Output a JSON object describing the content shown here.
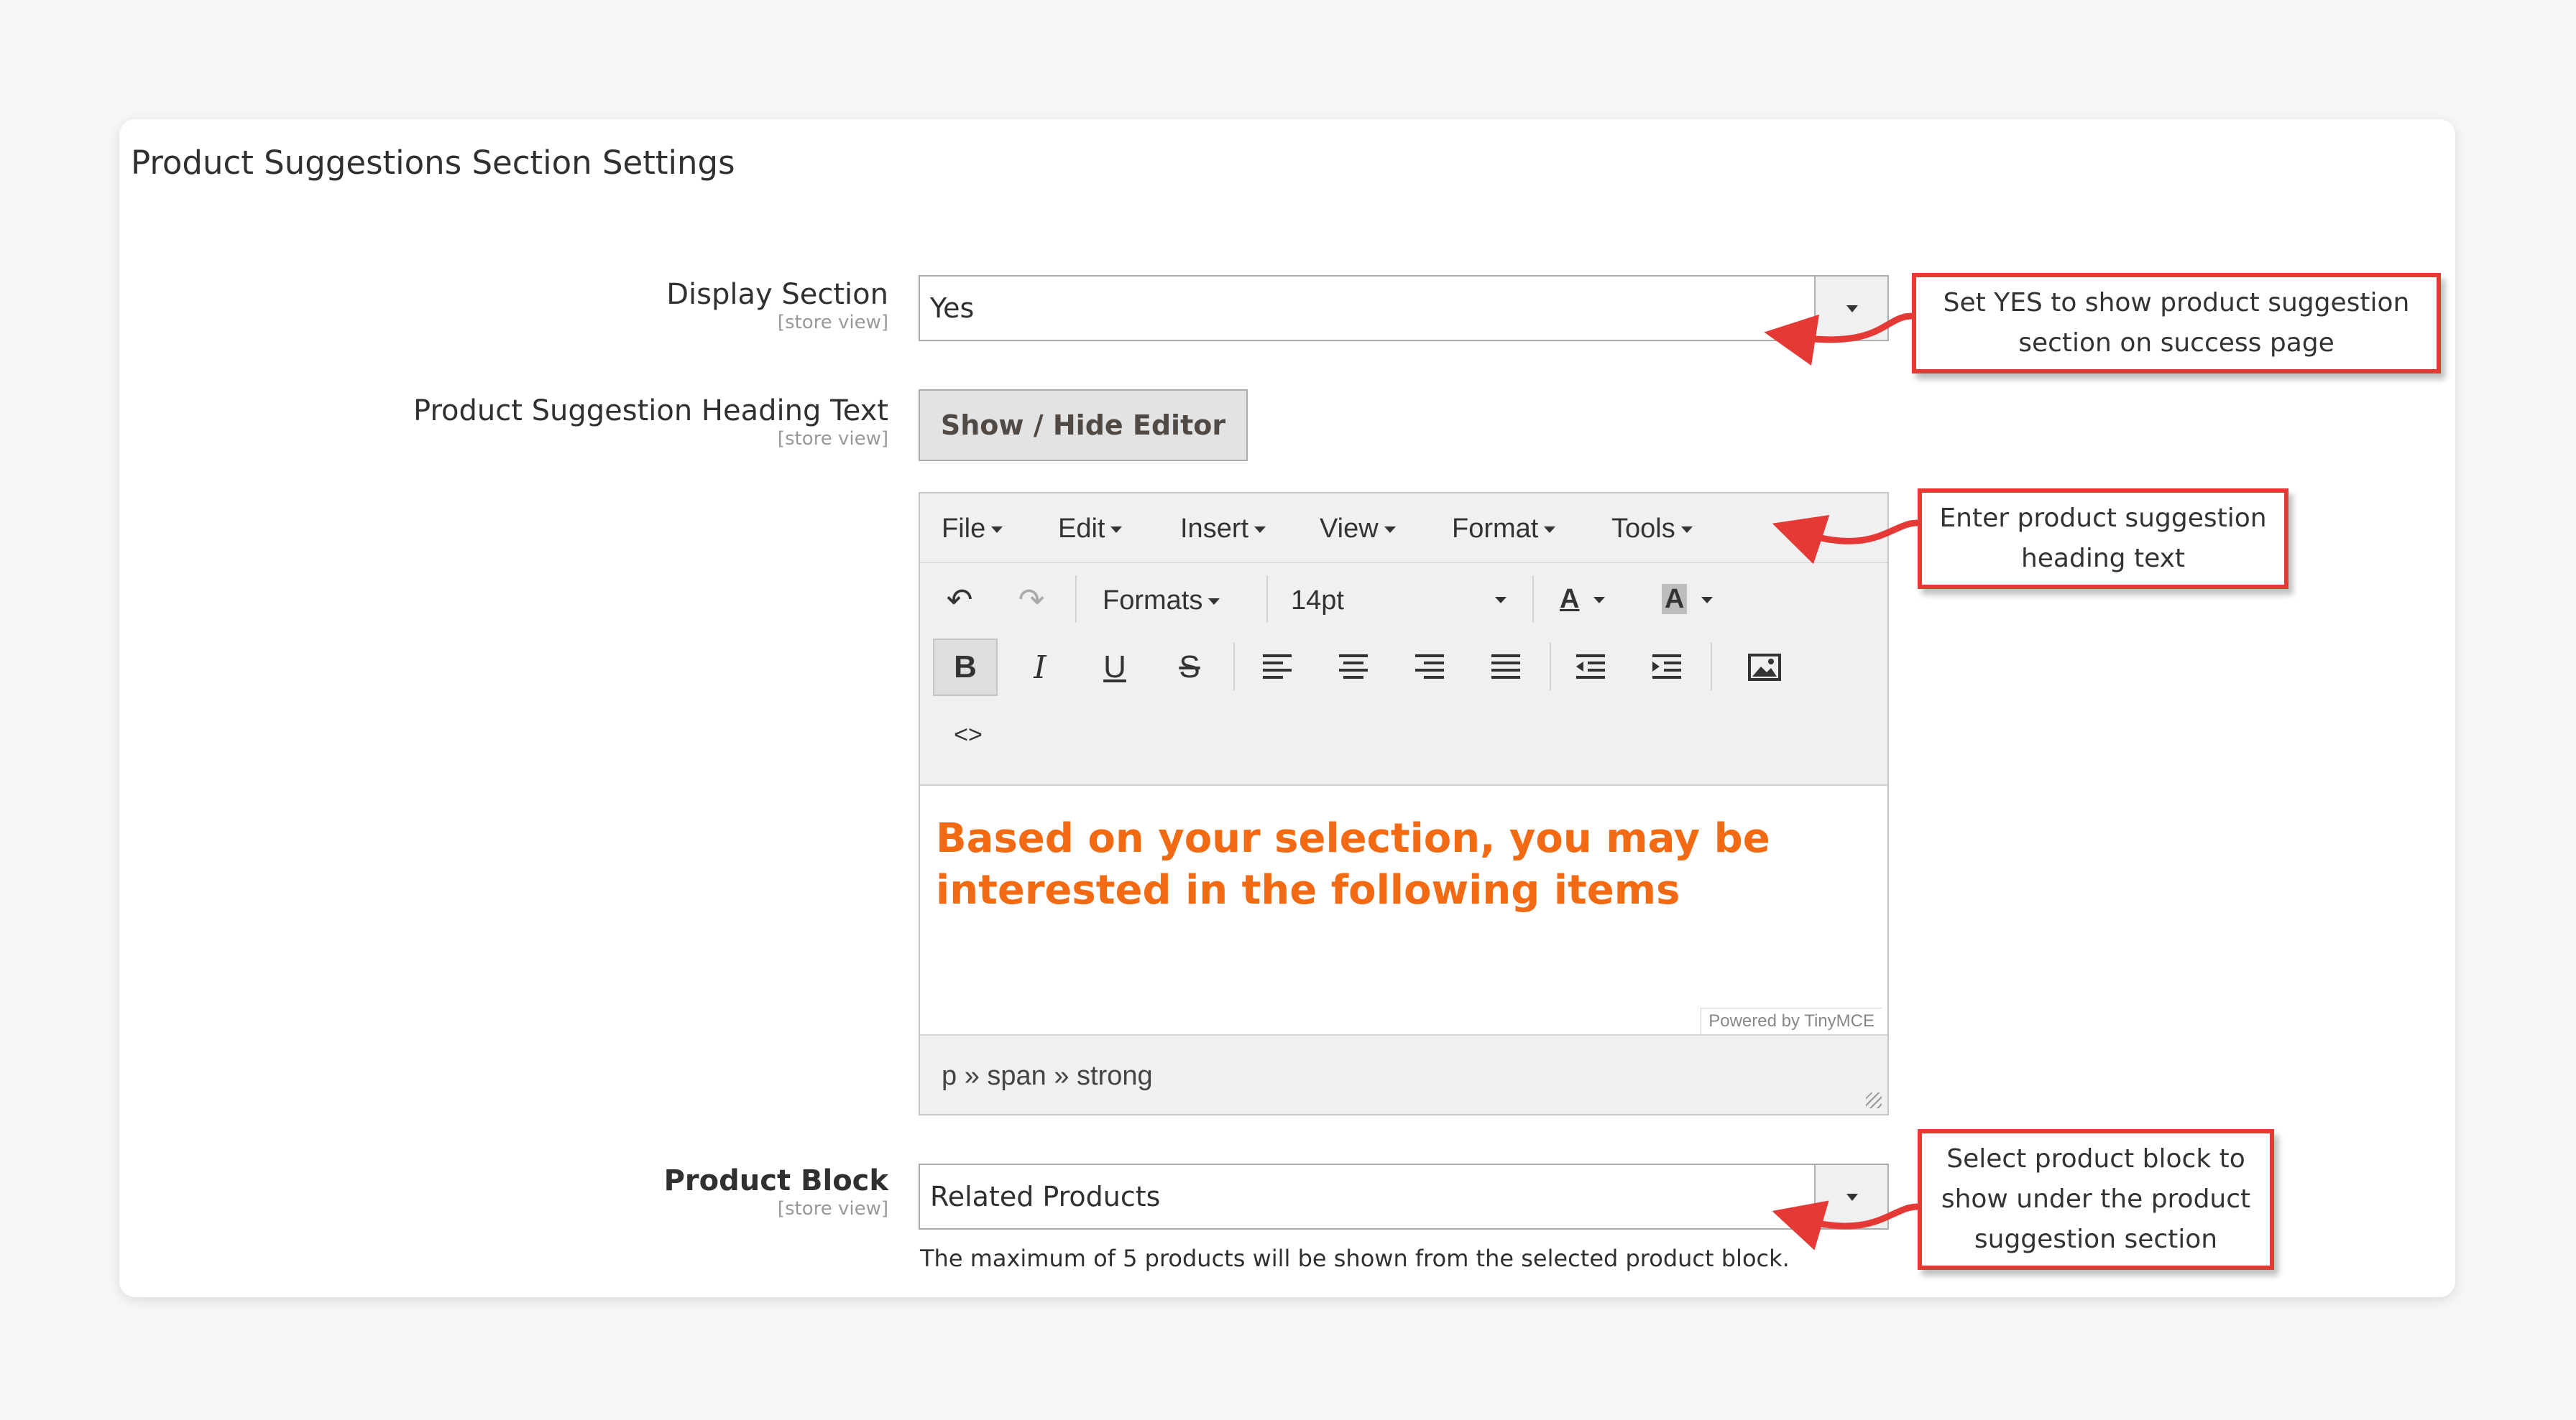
{
  "section": {
    "title": "Product Suggestions Section Settings"
  },
  "scope_label": "[store view]",
  "display_section": {
    "label": "Display Section",
    "value": "Yes"
  },
  "heading_text": {
    "label": "Product Suggestion Heading Text",
    "toggle_button": "Show / Hide Editor"
  },
  "editor": {
    "menus": [
      "File",
      "Edit",
      "Insert",
      "View",
      "Format",
      "Tools"
    ],
    "formats_label": "Formats",
    "font_size": "14pt",
    "text_color_glyph": "A",
    "bg_color_glyph": "A",
    "content": "Based on your selection, you may be interested in the following items",
    "content_color": "#f26a13",
    "powered_by": "Powered by TinyMCE",
    "status_path": "p » span » strong",
    "icons": [
      "undo-icon",
      "redo-icon",
      "bold-icon",
      "italic-icon",
      "underline-icon",
      "strikethrough-icon",
      "align-left-icon",
      "align-center-icon",
      "align-right-icon",
      "align-justify-icon",
      "outdent-icon",
      "indent-icon",
      "image-icon",
      "code-icon"
    ]
  },
  "product_block": {
    "label": "Product Block",
    "value": "Related Products",
    "hint": "The maximum of 5 products will be shown from the selected product block."
  },
  "annotations": {
    "display": "Set YES to show product suggestion section on success page",
    "heading": "Enter product suggestion heading text",
    "block": "Select product block to show under the product suggestion section",
    "color": "#e53935"
  }
}
